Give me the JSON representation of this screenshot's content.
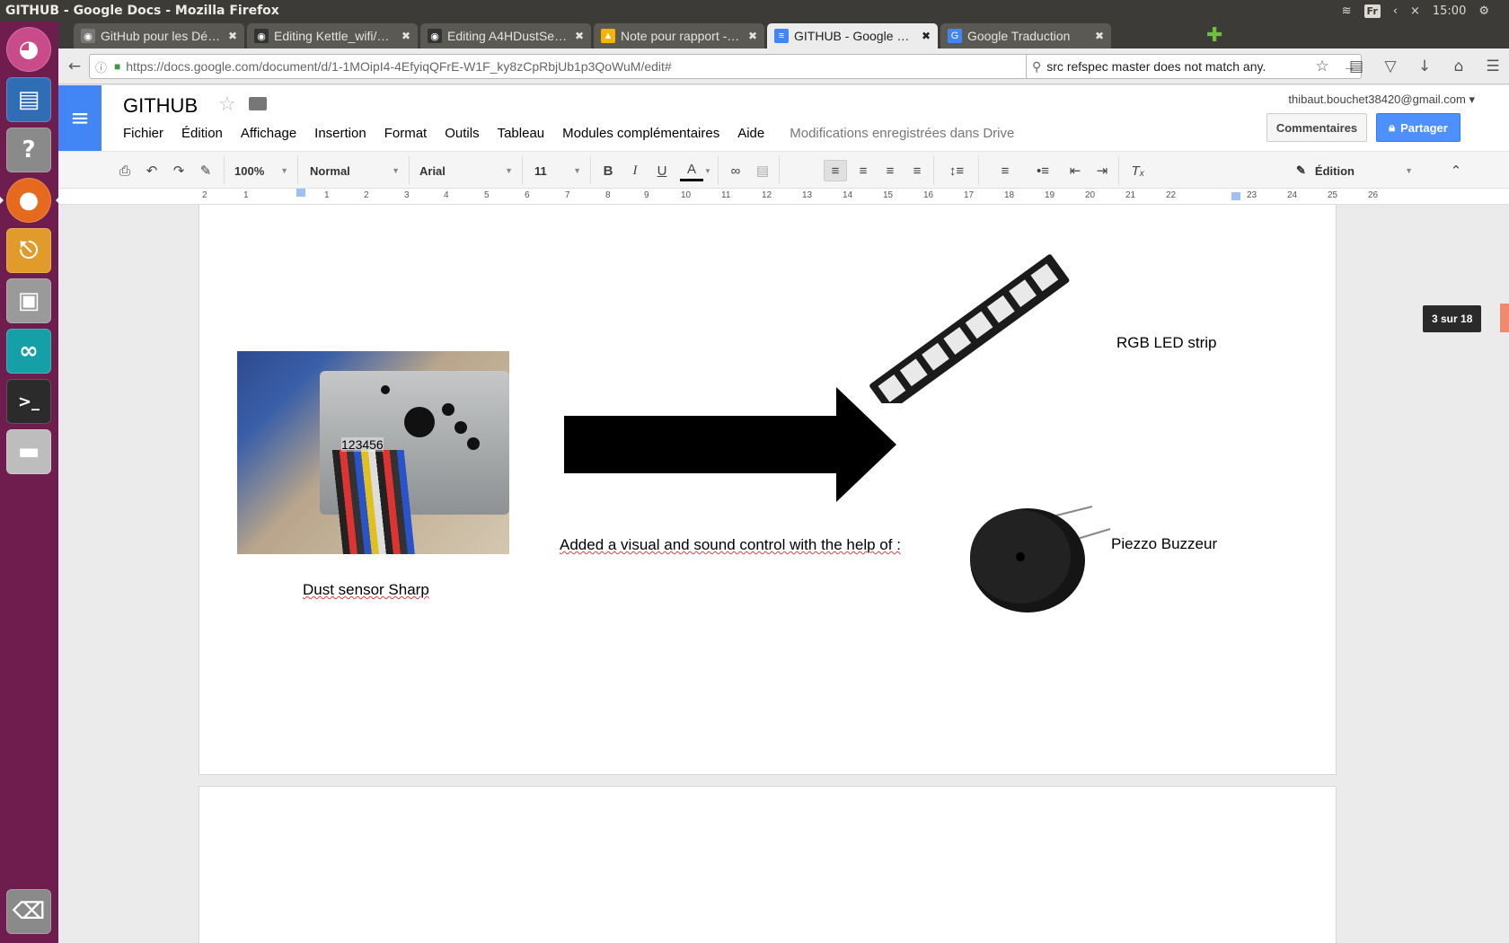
{
  "window": {
    "title": "GITHUB - Google Docs - Mozilla Firefox"
  },
  "system": {
    "keyboard_layout": "Fr",
    "time": "15:00"
  },
  "launcher": {
    "items": [
      "ubuntu-dash",
      "libreoffice-writer",
      "help",
      "firefox",
      "electronics-tool",
      "file-manager",
      "arduino",
      "terminal",
      "drive"
    ],
    "trash": "trash"
  },
  "tabs": [
    {
      "label": "GitHub pour les Déb…",
      "icon_color": "#777777"
    },
    {
      "label": "Editing Kettle_wifi/…",
      "icon_color": "#333333"
    },
    {
      "label": "Editing A4HDustSen…",
      "icon_color": "#333333"
    },
    {
      "label": "Note pour rapport - …",
      "icon_color": "#f4b400"
    },
    {
      "label": "GITHUB - Google Docs",
      "icon_color": "#4285f4"
    },
    {
      "label": "Google Traduction",
      "icon_color": "#4285f4"
    }
  ],
  "nav": {
    "url": "https://docs.google.com/document/d/1-1MOipI4-4EfyiqQFrE-W1F_ky8zCpRbjUb1p3QoWuM/edit#",
    "search": "src refspec master does not match any."
  },
  "docs": {
    "title": "GITHUB",
    "menu": [
      "Fichier",
      "Édition",
      "Affichage",
      "Insertion",
      "Format",
      "Outils",
      "Tableau",
      "Modules complémentaires",
      "Aide"
    ],
    "saved_status": "Modifications enregistrées dans Drive",
    "account": "thibaut.bouchet38420@gmail.com",
    "comments_label": "Commentaires",
    "share_label": "Partager"
  },
  "toolbar": {
    "zoom": "100%",
    "style": "Normal",
    "font": "Arial",
    "size": "11",
    "mode": "Édition"
  },
  "ruler": {
    "ticks": [
      "2",
      "1",
      "1",
      "2",
      "3",
      "4",
      "5",
      "6",
      "7",
      "8",
      "9",
      "10",
      "11",
      "12",
      "13",
      "14",
      "15",
      "16",
      "17",
      "18",
      "19",
      "20",
      "21",
      "22",
      "23",
      "24",
      "25",
      "26"
    ]
  },
  "document": {
    "sensor_pins": "123456",
    "sensor_caption": "Dust sensor Sharp",
    "added_text": "Added a visual and sound control with the help of :",
    "led_caption": "RGB LED strip",
    "buzzer_caption": "Piezzo Buzzeur"
  },
  "page_counter": "3 sur 18",
  "colors": {
    "launcher": "#6f1c4e",
    "docs_blue": "#4285f4",
    "share_blue": "#4d90fe",
    "spell_error": "#e04040"
  }
}
